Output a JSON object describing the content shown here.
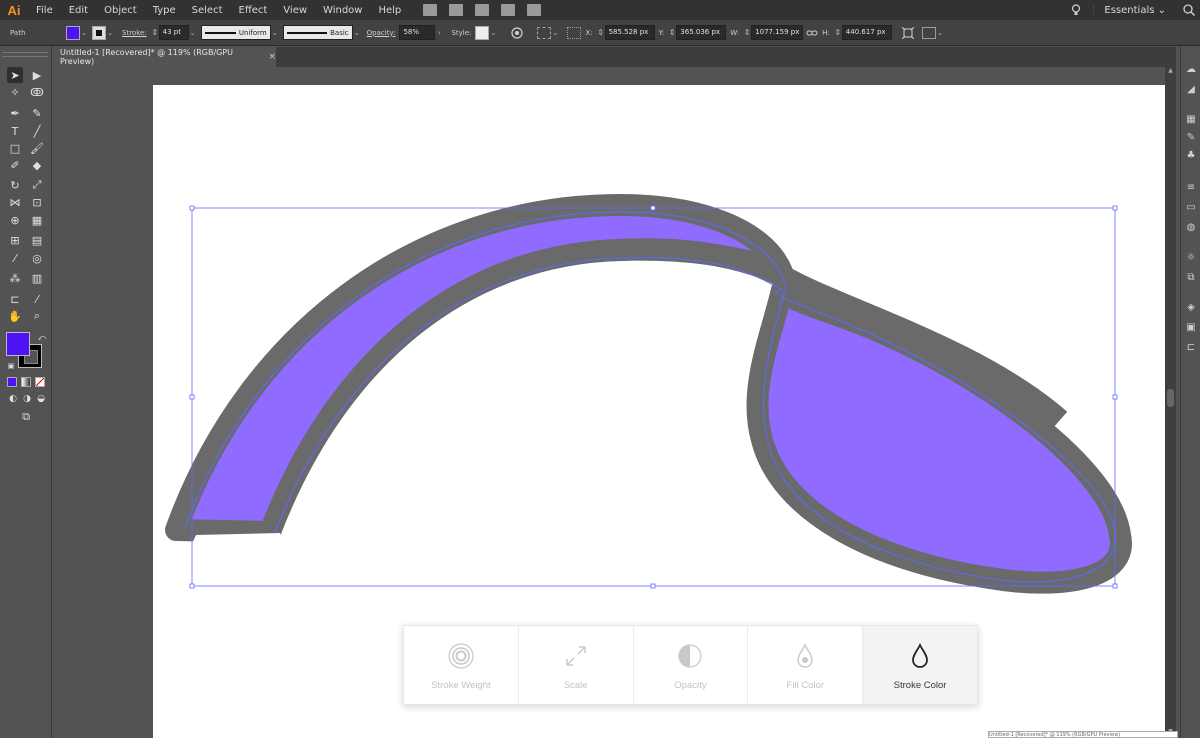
{
  "app": {
    "logo": "Ai",
    "menus": [
      "File",
      "Edit",
      "Object",
      "Type",
      "Select",
      "Effect",
      "View",
      "Window",
      "Help"
    ],
    "workspace": "Essentials"
  },
  "control_bar": {
    "selection_type": "Path",
    "fill_color": "#4f12f5",
    "stroke_label": "Stroke:",
    "stroke_weight": "43 pt",
    "profile": "Uniform",
    "brush": "Basic",
    "opacity_label": "Opacity:",
    "opacity": "58%",
    "style_label": "Style:",
    "x_label": "X:",
    "x_value": "585.528 px",
    "y_label": "Y:",
    "y_value": "365.036 px",
    "w_label": "W:",
    "w_value": "1077.159 px",
    "h_label": "H:",
    "h_value": "440.617 px"
  },
  "document": {
    "tab_title": "Untitled-1 [Recovered]* @ 119% (RGB/GPU Preview)",
    "close_glyph": "×"
  },
  "artwork": {
    "stroke_color": "#6a6a6a",
    "fill_color": "#8f6cff",
    "selection_color": "#5b6bff"
  },
  "touch_bar": {
    "items": [
      {
        "label": "Stroke Weight",
        "icon": "stroke-weight-icon",
        "active": false
      },
      {
        "label": "Scale",
        "icon": "scale-icon",
        "active": false
      },
      {
        "label": "Opacity",
        "icon": "opacity-icon",
        "active": false
      },
      {
        "label": "Fill Color",
        "icon": "fill-color-icon",
        "active": false
      },
      {
        "label": "Stroke Color",
        "icon": "stroke-color-icon",
        "active": true
      }
    ]
  },
  "status": {
    "text": "Untitled-1 [Recovered]* @ 119% (RGB/GPU Preview)"
  }
}
